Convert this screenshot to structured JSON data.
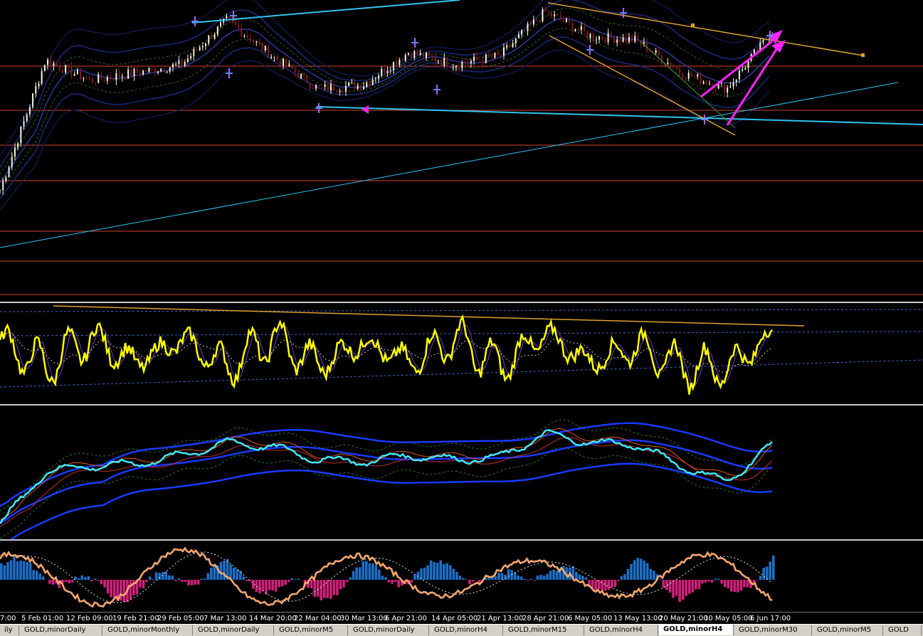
{
  "time_axis": {
    "labels": [
      "7:00",
      "5 Feb 01:00",
      "12 Feb 09:00",
      "19 Feb 21:00",
      "29 Feb 05:00",
      "7 Mar 13:00",
      "14 Mar 20:00",
      "22 Mar 04:00",
      "30 Mar 13:00",
      "6 Apr 21:00",
      "14 Apr 05:00",
      "21 Apr 13:00",
      "28 Apr 21:00",
      "6 May 05:00",
      "13 May 13:00",
      "20 May 21:00",
      "30 May 05:00",
      "6 Jun 17:00"
    ]
  },
  "tabs": [
    {
      "label": "ily",
      "active": false
    },
    {
      "label": "GOLD,minorDaily",
      "active": false
    },
    {
      "label": "GOLD,minorMonthly",
      "active": false
    },
    {
      "label": "GOLD,minorDaily",
      "active": false
    },
    {
      "label": "GOLD,minorM5",
      "active": false
    },
    {
      "label": "GOLD,minorDaily",
      "active": false
    },
    {
      "label": "GOLD,minorH4",
      "active": false
    },
    {
      "label": "GOLD,minorM15",
      "active": false
    },
    {
      "label": "GOLD,minorH4",
      "active": false
    },
    {
      "label": "GOLD,minorH4",
      "active": true
    },
    {
      "label": "GOLD,minorM30",
      "active": false
    },
    {
      "label": "GOLD,minorM5",
      "active": false
    },
    {
      "label": "GOLD",
      "active": false
    }
  ],
  "colors": {
    "background": "#000000",
    "bull_candle": "#f5f5dc",
    "bear_candle": "#8b1a1a",
    "horizontal_level": "#d2452d",
    "trendline_cyan": "#2ec4f0",
    "trendline_orange": "#e0a030",
    "arrow_magenta": "#ff22ff",
    "rsi_line": "#ffff00",
    "cyan_line": "#40e8ff",
    "histogram_up": "#1e6fc8",
    "histogram_down": "#d0207a",
    "oscillator_line": "#ffc8a0"
  },
  "chart_data": [
    {
      "type": "candlestick",
      "pane": "price",
      "x": [
        "7:00",
        "5 Feb 01:00",
        "12 Feb 09:00",
        "19 Feb 21:00",
        "29 Feb 05:00",
        "7 Mar 13:00",
        "14 Mar 20:00",
        "22 Mar 04:00",
        "30 Mar 13:00",
        "6 Apr 21:00",
        "14 Apr 05:00",
        "21 Apr 13:00",
        "28 Apr 21:00",
        "6 May 05:00",
        "13 May 13:00",
        "20 May 21:00",
        "30 May 05:00",
        "6 Jun 17:00"
      ],
      "close_trend": [
        0.08,
        0.72,
        0.62,
        0.66,
        0.7,
        0.92,
        0.74,
        0.58,
        0.6,
        0.76,
        0.7,
        0.74,
        0.96,
        0.84,
        0.82,
        0.66,
        0.58,
        0.86
      ]
    },
    {
      "type": "line",
      "pane": "oscillator-1",
      "series": [
        {
          "values": [
            0.8,
            0.2,
            0.9,
            0.3,
            0.85,
            0.2,
            0.9,
            0.25,
            0.8,
            0.3,
            0.9,
            0.2,
            1.0,
            0.3,
            0.7,
            0.2,
            0.15,
            0.95
          ]
        }
      ]
    },
    {
      "type": "line",
      "pane": "oscillator-2",
      "series": [
        {
          "values": [
            0.05,
            0.55,
            0.6,
            0.62,
            0.7,
            0.82,
            0.78,
            0.66,
            0.64,
            0.7,
            0.66,
            0.68,
            0.9,
            0.82,
            0.8,
            0.6,
            0.45,
            0.8
          ]
        }
      ]
    },
    {
      "type": "histogram",
      "pane": "oscillator-3",
      "series": [
        {
          "values": [
            0.6,
            0.3,
            -0.4,
            -0.5,
            0.2,
            0.4,
            -0.3,
            -0.6,
            0.3,
            0.2,
            0.6,
            -0.2,
            0.7,
            -0.3,
            0.5,
            -0.5,
            -0.4,
            0.7
          ]
        }
      ]
    }
  ]
}
